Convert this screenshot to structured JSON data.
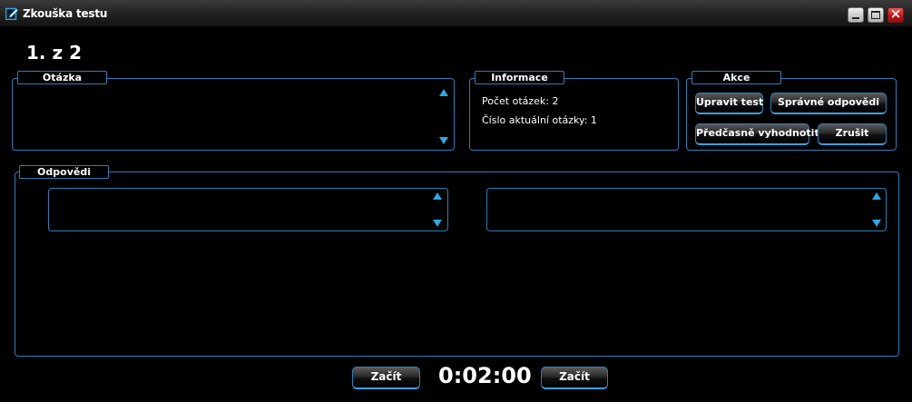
{
  "window": {
    "title": "Zkouška testu"
  },
  "counter": "1. z 2",
  "question_group": {
    "legend": "Otázka"
  },
  "info_group": {
    "legend": "Informace",
    "question_count": "Počet otázek: 2",
    "current_question": "Číslo aktuální otázky: 1"
  },
  "actions_group": {
    "legend": "Akce",
    "edit_test": "Upravit test",
    "correct_answers": "Správné odpovědi",
    "early_evaluate": "Předčasně vyhodnotit",
    "cancel": "Zrušit"
  },
  "answers_group": {
    "legend": "Odpovědi"
  },
  "footer": {
    "start_left": "Začít",
    "timer": "0:02:00",
    "start_right": "Začít"
  },
  "colors": {
    "accent": "#2c7fb8",
    "arrow": "#2aa8e8",
    "background": "#000000"
  }
}
